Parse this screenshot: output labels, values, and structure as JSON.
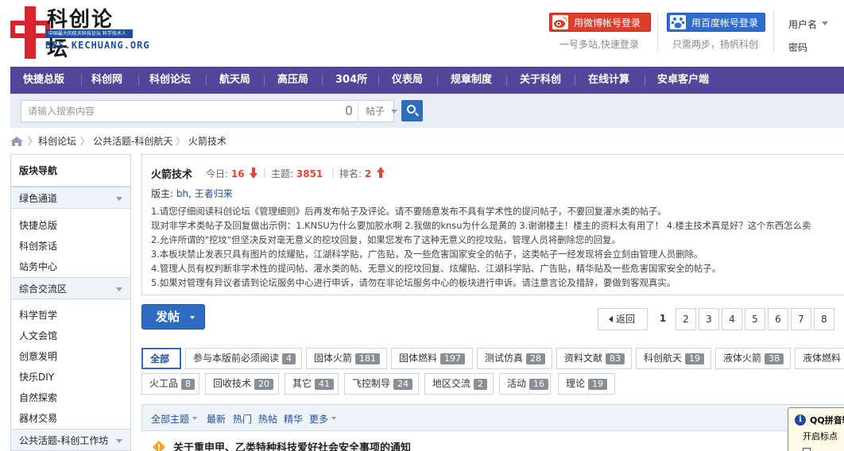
{
  "site": {
    "logo_title": "科创论坛",
    "logo_band": "中国最大的航天科技论坛 科学技术人",
    "logo_url": "BBS.KECHUANG.ORG"
  },
  "header": {
    "weibo_login": "用微博帐号登录",
    "weibo_sub": "一号多站,快速登录",
    "baidu_login": "用百度帐号登录",
    "baidu_sub": "只需两步，扬帆科创",
    "username_label": "用户名",
    "password_label": "密码"
  },
  "nav": {
    "items": [
      "快捷总版",
      "科创网",
      "科创论坛",
      "航天局",
      "高压局",
      "304所",
      "仪表局",
      "规章制度",
      "关于科创",
      "在线计算",
      "安卓客户端"
    ]
  },
  "search": {
    "placeholder": "请输入搜索内容",
    "type": "帖子"
  },
  "breadcrumb": [
    "科创论坛",
    "公共活题-科创航天",
    "火箭技术"
  ],
  "sidebar": {
    "title": "版块导航",
    "groups": [
      {
        "label": "绿色通道",
        "items": [
          "快捷总版",
          "科创茶话",
          "站务中心"
        ]
      },
      {
        "label": "综合交流区",
        "items": [
          "科学哲学",
          "人文会馆",
          "创意发明",
          "快乐DIY",
          "自然探索",
          "器材交易"
        ]
      },
      {
        "label": "公共活题-科创工作坊",
        "items": []
      }
    ]
  },
  "forum": {
    "name": "火箭技术",
    "today_label": "今日:",
    "today_value": "16",
    "topics_label": "主题:",
    "topics_value": "3851",
    "rank_label": "排名:",
    "rank_value": "2",
    "mods_label": "版主:",
    "mods": [
      "bh",
      "王者归来"
    ],
    "rules": [
      "1.请您仔细阅读科创论坛《管理细则》后再发布帖子及评论。请不要随意发布不具有学术性的提问帖子，不要回复灌水类的帖子。",
      "现对非学术类帖子及回复做出示例：1.KNSU为什么要加胶水啊 2.我做的knsu为什么是黄的 3.谢谢楼主！楼主的资料太有用了！  4.楼主技术真是好？这个东西怎么卖",
      "2.允许所谓的\"挖坟\"但坚决反对毫无意义的挖坟回复，如果您发布了这种无意义的挖坟贴，管理人员将删除您的回复。",
      "3.本板块禁止发表只具有图片的炫耀贴，江湖科学贴，广告贴，及一些危害国家安全的帖子，这类帖子一经发现将会立刻由管理人员删除。",
      "4.管理人员有权判断非学术性的提问帖、灌水类的帖、无意义的挖坟回复、炫耀贴、江湖科学贴、广告贴，精华贴及一些危害国家安全的帖子。",
      "5.如果对管理有异议者请到论坛服务中心进行申诉，请勿在非论坛服务中心的板块进行申诉。请注意言论及措辞，要做到客观真实。"
    ]
  },
  "post_button": "发帖",
  "pager": {
    "back": "返回",
    "pages": [
      "1",
      "2",
      "3",
      "4",
      "5",
      "6",
      "7",
      "8"
    ],
    "current": "1"
  },
  "tags_row1": [
    {
      "label": "全部",
      "count": ""
    },
    {
      "label": "参与本版前必须阅读",
      "count": "4"
    },
    {
      "label": "固体火箭",
      "count": "181"
    },
    {
      "label": "固体燃料",
      "count": "197"
    },
    {
      "label": "测试仿真",
      "count": "28"
    },
    {
      "label": "资料文献",
      "count": "83"
    },
    {
      "label": "科创航天",
      "count": "19"
    },
    {
      "label": "液体火箭",
      "count": "38"
    },
    {
      "label": "液体燃料",
      "count": ""
    }
  ],
  "tags_row2": [
    {
      "label": "火工品",
      "count": "8"
    },
    {
      "label": "回收技术",
      "count": "20"
    },
    {
      "label": "其它",
      "count": "41"
    },
    {
      "label": "飞控制导",
      "count": "24"
    },
    {
      "label": "地区交流",
      "count": "2"
    },
    {
      "label": "活动",
      "count": "16"
    },
    {
      "label": "理论",
      "count": "19"
    }
  ],
  "filter": {
    "all_topics": "全部主题",
    "items": [
      "最新",
      "热门",
      "热帖",
      "精华",
      "更多"
    ]
  },
  "thread": {
    "title": "关于重申甲、乙类特种科技爱好社会安全事项的通知"
  },
  "qq_popup": {
    "title": "QQ拼音输入法",
    "text": "开启标点",
    "icon": "i"
  }
}
